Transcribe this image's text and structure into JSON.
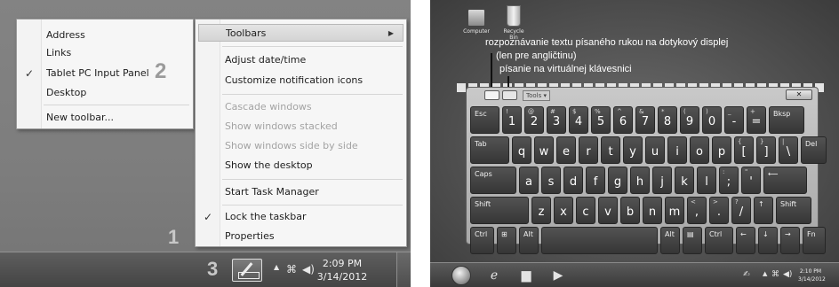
{
  "left": {
    "toolbars_submenu": [
      {
        "label": "Address",
        "checked": false
      },
      {
        "label": "Links",
        "checked": false
      },
      {
        "label": "Tablet PC Input Panel",
        "checked": true
      },
      {
        "label": "Desktop",
        "checked": false
      },
      {
        "label": "New toolbar...",
        "checked": false
      }
    ],
    "context_menu": {
      "toolbars": "Toolbars",
      "adjust": "Adjust date/time",
      "customize": "Customize notification icons",
      "cascade": "Cascade windows",
      "stacked": "Show windows stacked",
      "side": "Show windows side by side",
      "desktop": "Show the desktop",
      "taskmgr": "Start Task Manager",
      "lock": "Lock the taskbar",
      "properties": "Properties"
    },
    "callouts": {
      "one": "1",
      "two": "2",
      "three": "3"
    },
    "clock": {
      "time": "2:09 PM",
      "date": "3/14/2012"
    }
  },
  "right": {
    "desktop_icons": {
      "computer": "Computer",
      "recycle": "Recycle Bin"
    },
    "annotations": {
      "line1": "rozpoznávanie textu písaného rukou na dotykový displej",
      "line2": "(len pre angličtinu)",
      "line3": "písanie na virtuálnej klávesnici"
    },
    "keyboard": {
      "tools": "Tools",
      "rows": [
        [
          {
            "m": "Esc",
            "s": "",
            "w": 33,
            "label": true
          },
          {
            "m": "1",
            "s": "!"
          },
          {
            "m": "2",
            "s": "@"
          },
          {
            "m": "3",
            "s": "#"
          },
          {
            "m": "4",
            "s": "$"
          },
          {
            "m": "5",
            "s": "%"
          },
          {
            "m": "6",
            "s": "^"
          },
          {
            "m": "7",
            "s": "&"
          },
          {
            "m": "8",
            "s": "*"
          },
          {
            "m": "9",
            "s": "("
          },
          {
            "m": "0",
            "s": ")"
          },
          {
            "m": "-",
            "s": "_"
          },
          {
            "m": "=",
            "s": "+"
          },
          {
            "m": "Bksp",
            "s": "",
            "w": 40,
            "label": true
          }
        ],
        [
          {
            "m": "Tab",
            "s": "",
            "w": 44,
            "label": true
          },
          {
            "m": "q"
          },
          {
            "m": "w"
          },
          {
            "m": "e"
          },
          {
            "m": "r"
          },
          {
            "m": "t"
          },
          {
            "m": "y"
          },
          {
            "m": "u"
          },
          {
            "m": "i"
          },
          {
            "m": "o"
          },
          {
            "m": "p"
          },
          {
            "m": "[",
            "s": "{"
          },
          {
            "m": "]",
            "s": "}"
          },
          {
            "m": "\\",
            "s": "|"
          },
          {
            "m": "Del",
            "s": "",
            "w": 29,
            "label": true
          }
        ],
        [
          {
            "m": "Caps",
            "s": "",
            "w": 52,
            "label": true
          },
          {
            "m": "a"
          },
          {
            "m": "s"
          },
          {
            "m": "d"
          },
          {
            "m": "f"
          },
          {
            "m": "g"
          },
          {
            "m": "h"
          },
          {
            "m": "j"
          },
          {
            "m": "k"
          },
          {
            "m": "l"
          },
          {
            "m": ";",
            "s": ":"
          },
          {
            "m": "'",
            "s": "\""
          },
          {
            "m": "⟵",
            "s": "",
            "w": 49,
            "label": true
          }
        ],
        [
          {
            "m": "Shift",
            "s": "",
            "w": 66,
            "label": true
          },
          {
            "m": "z"
          },
          {
            "m": "x"
          },
          {
            "m": "c"
          },
          {
            "m": "v"
          },
          {
            "m": "b"
          },
          {
            "m": "n"
          },
          {
            "m": "m"
          },
          {
            "m": ",",
            "s": "<"
          },
          {
            "m": ".",
            "s": ">"
          },
          {
            "m": "/",
            "s": "?"
          },
          {
            "m": "↑",
            "s": "",
            "w": 22,
            "label": true
          },
          {
            "m": "Shift",
            "s": "",
            "w": 40,
            "label": true
          }
        ],
        [
          {
            "m": "Ctrl",
            "s": "",
            "w": 27,
            "label": true
          },
          {
            "m": "⊞",
            "s": "",
            "w": 22,
            "label": true
          },
          {
            "m": "Alt",
            "s": "",
            "w": 22,
            "label": true
          },
          {
            "m": "",
            "s": "",
            "w": 131,
            "label": true
          },
          {
            "m": "Alt",
            "s": "",
            "w": 22,
            "label": true
          },
          {
            "m": "▤",
            "s": "",
            "w": 22,
            "label": true
          },
          {
            "m": "Ctrl",
            "s": "",
            "w": 32,
            "label": true
          },
          {
            "m": "←",
            "s": "",
            "w": 22,
            "label": true
          },
          {
            "m": "↓",
            "s": "",
            "w": 22,
            "label": true
          },
          {
            "m": "→",
            "s": "",
            "w": 22,
            "label": true
          },
          {
            "m": "Fn",
            "s": "",
            "w": 26,
            "label": true
          }
        ]
      ]
    },
    "clock": {
      "time": "2:10 PM",
      "date": "3/14/2012"
    }
  },
  "colors": {
    "menu_bg": "#f6f6f6",
    "desktop": "#7d7d7d",
    "key": "#444444"
  }
}
